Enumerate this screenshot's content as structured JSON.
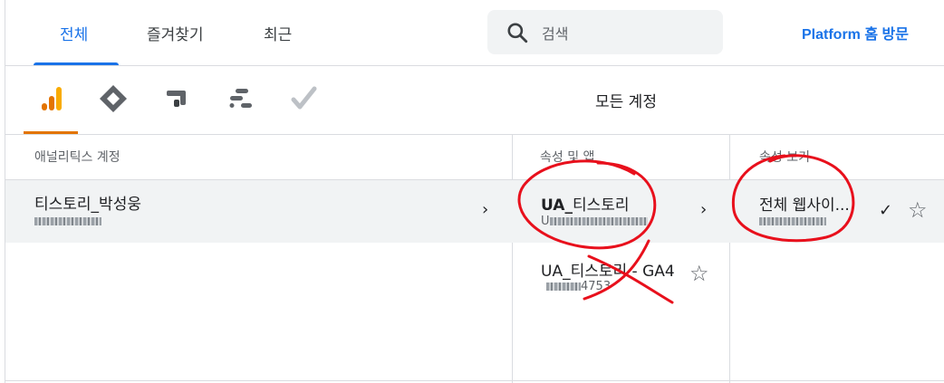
{
  "header": {
    "tabs": [
      {
        "label": "전체",
        "active": true
      },
      {
        "label": "즐겨찾기",
        "active": false
      },
      {
        "label": "최근",
        "active": false
      }
    ],
    "search_placeholder": "검색",
    "platform_link": "Platform 홈 방문"
  },
  "products": {
    "icons": [
      "analytics-icon",
      "tag-manager-icon",
      "optimize-icon",
      "data-studio-icon",
      "surveys-icon"
    ],
    "all_accounts_label": "모든 계정"
  },
  "columns": {
    "accounts_header": "애널리틱스 계정",
    "properties_header": "속성 및 앱",
    "views_header": "속성 보기"
  },
  "accounts": [
    {
      "name": "티스토리_박성웅"
    }
  ],
  "properties": [
    {
      "prefix": "UA_",
      "name": "티스토리",
      "id_prefix": "U"
    },
    {
      "name": "UA_티스토리 - GA4",
      "id_suffix": "4753"
    }
  ],
  "views": [
    {
      "name": "전체 웹사이..."
    }
  ],
  "colors": {
    "accent": "#1a73e8",
    "analytics_orange": "#e37400",
    "annotation_red": "#e8101c"
  }
}
